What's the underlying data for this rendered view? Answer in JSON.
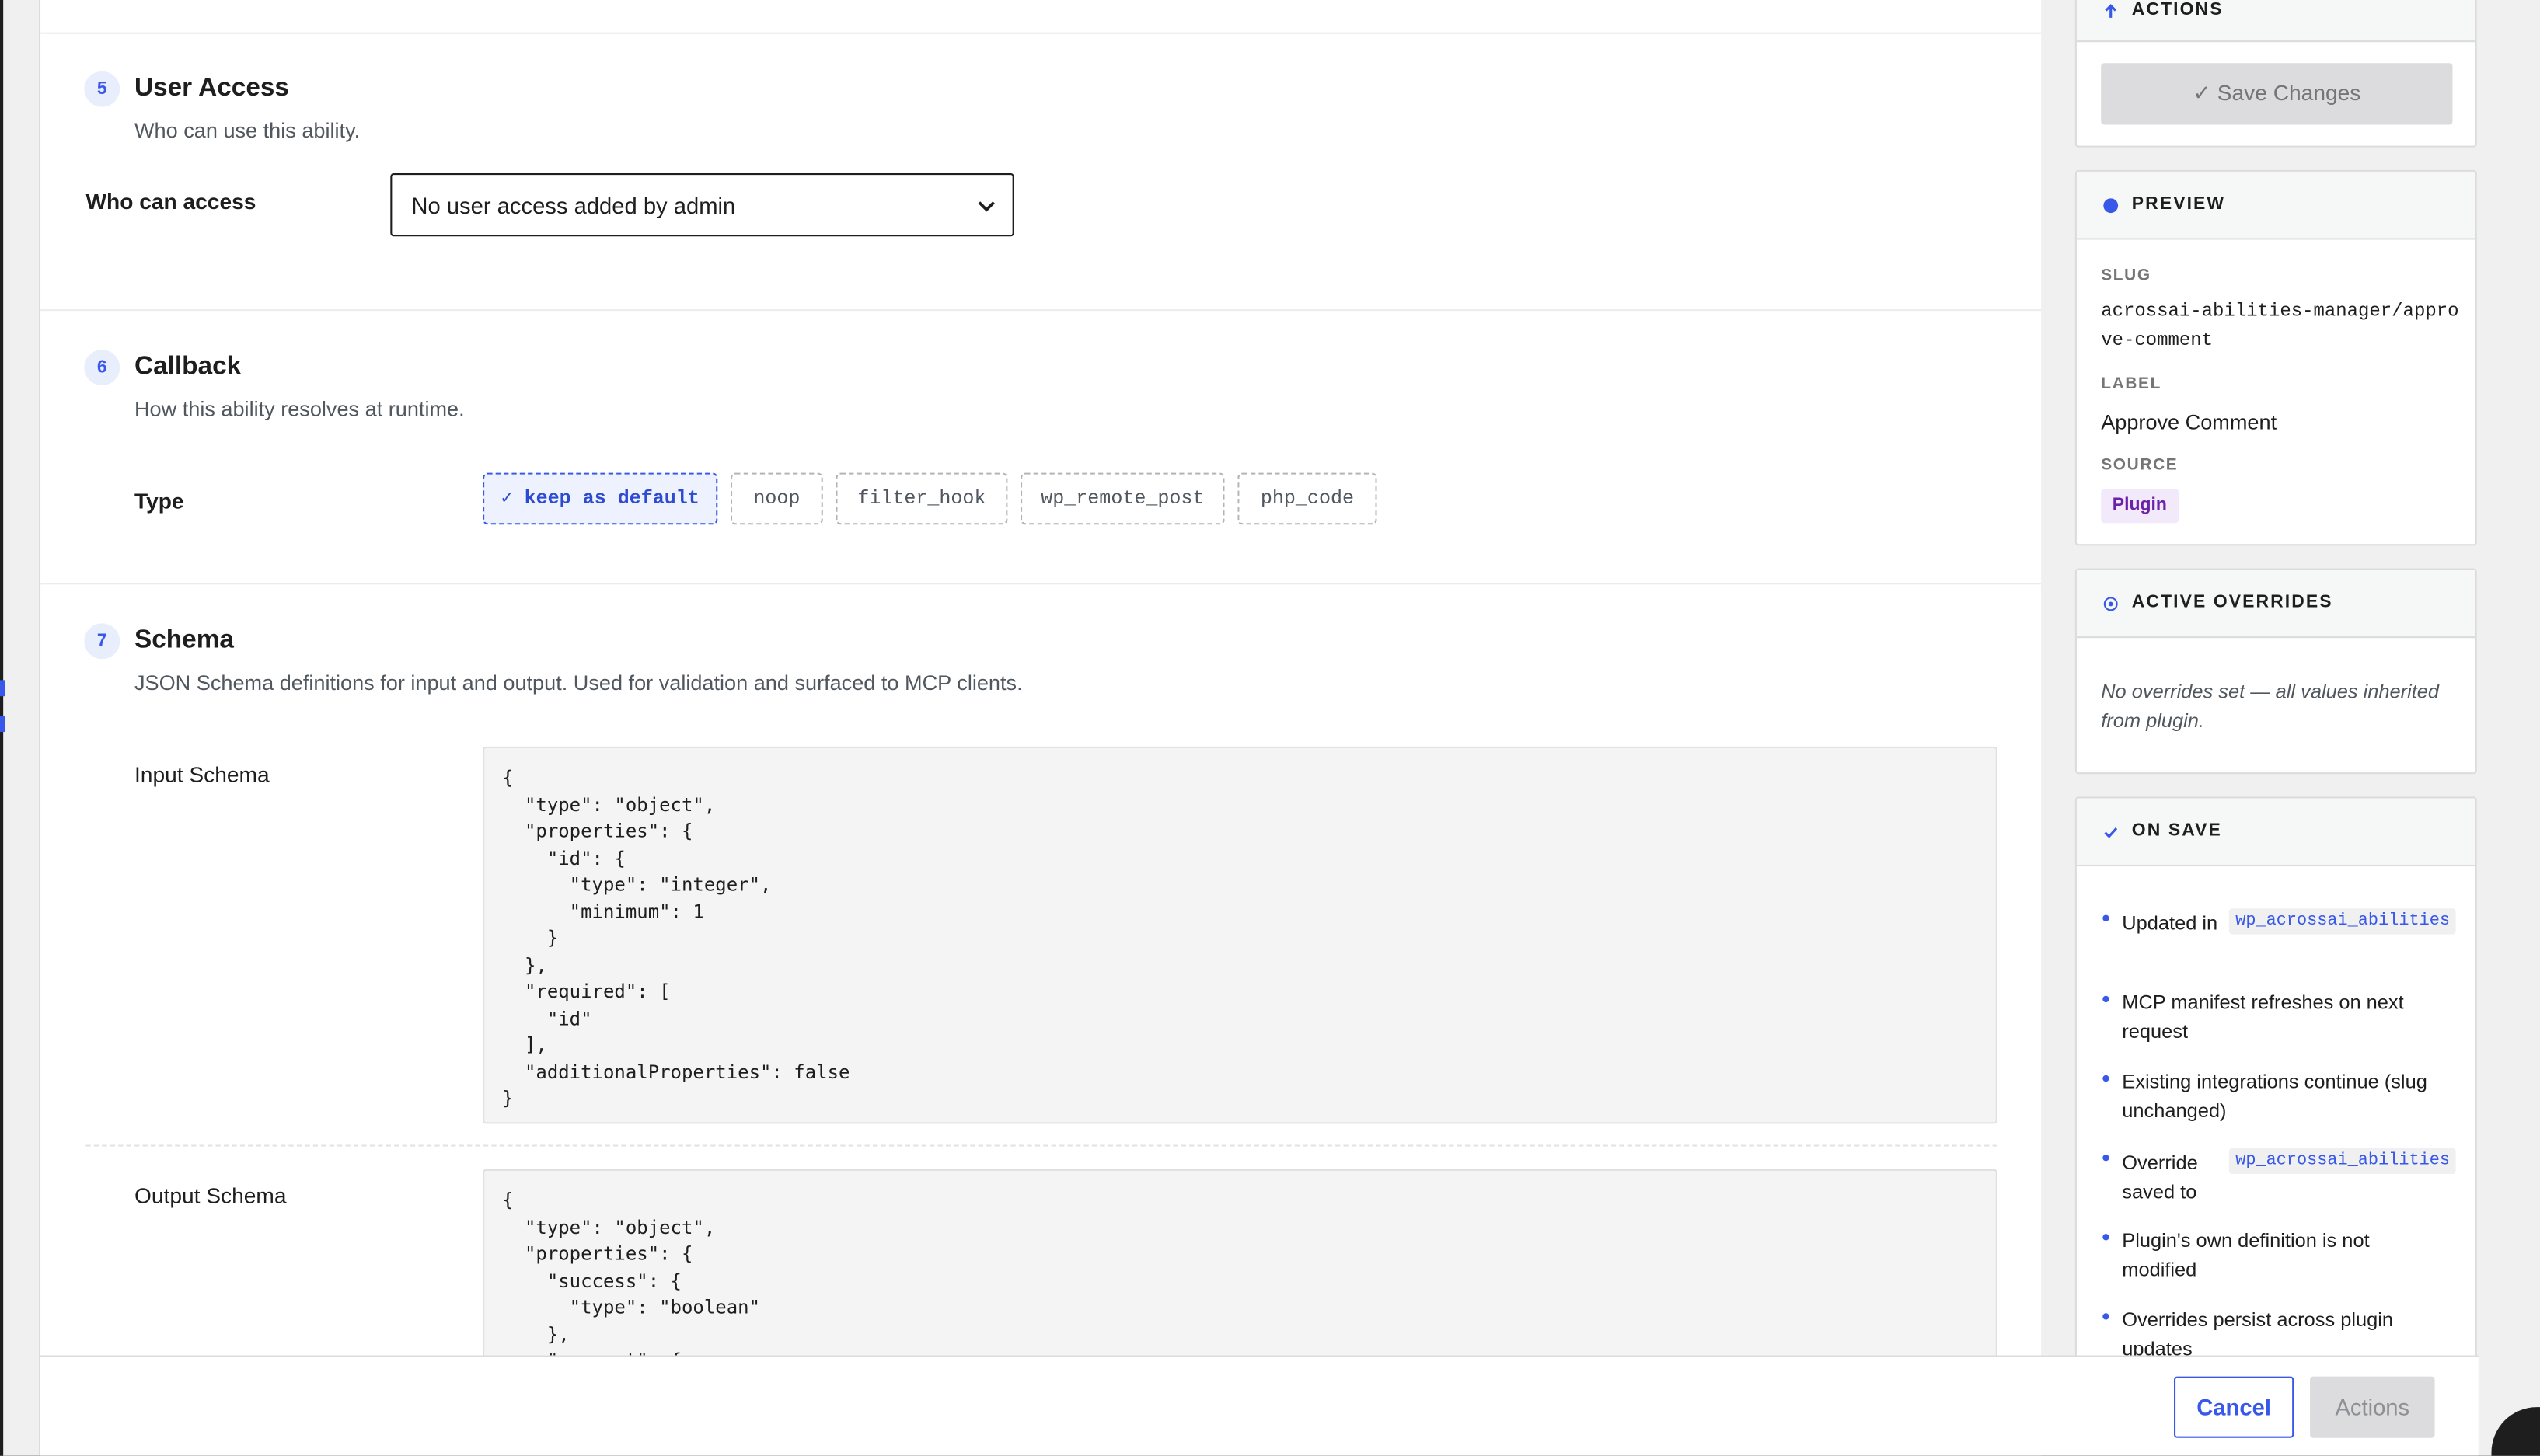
{
  "sections": {
    "user_access": {
      "number": "5",
      "title": "User Access",
      "description": "Who can use this ability.",
      "field_label": "Who can access",
      "select_value": "No user access added by admin"
    },
    "callback": {
      "number": "6",
      "title": "Callback",
      "description": "How this ability resolves at runtime.",
      "field_label": "Type",
      "options": [
        "✓ keep as default",
        "noop",
        "filter_hook",
        "wp_remote_post",
        "php_code"
      ],
      "selected": "keep as default"
    },
    "schema": {
      "number": "7",
      "title": "Schema",
      "description": "JSON Schema definitions for input and output. Used for validation and surfaced to MCP clients.",
      "input_label": "Input Schema",
      "input_code": "{\n  \"type\": \"object\",\n  \"properties\": {\n    \"id\": {\n      \"type\": \"integer\",\n      \"minimum\": 1\n    }\n  },\n  \"required\": [\n    \"id\"\n  ],\n  \"additionalProperties\": false\n}",
      "output_label": "Output Schema",
      "output_code": "{\n  \"type\": \"object\",\n  \"properties\": {\n    \"success\": {\n      \"type\": \"boolean\"\n    },\n    \"comment\": {"
    }
  },
  "sidebar": {
    "actions": {
      "title": "ACTIONS",
      "save_label": "✓ Save Changes"
    },
    "preview": {
      "title": "PREVIEW",
      "slug_label": "SLUG",
      "slug_value": "acrossai-abilities-manager/approve-comment",
      "label_label": "LABEL",
      "label_value": "Approve Comment",
      "source_label": "SOURCE",
      "source_value": "Plugin"
    },
    "overrides": {
      "title": "ACTIVE OVERRIDES",
      "text": "No overrides set — all values inherited from plugin."
    },
    "on_save": {
      "title": "ON SAVE",
      "items": [
        {
          "text": "Updated in",
          "code": "wp_acrossai_abilities"
        },
        {
          "text": "MCP manifest refreshes on next request"
        },
        {
          "text": "Existing integrations continue (slug unchanged)"
        },
        {
          "text": "Override saved to",
          "code": "wp_acrossai_abilities"
        },
        {
          "text": "Plugin's own definition is not modified"
        },
        {
          "text": "Overrides persist across plugin updates"
        }
      ]
    }
  },
  "footer": {
    "cancel_label": "Cancel",
    "actions_label": "Actions"
  },
  "colors": {
    "accent": "#3858e9",
    "source_badge_bg": "#f2e9fb",
    "source_badge_text": "#6b21a8"
  }
}
